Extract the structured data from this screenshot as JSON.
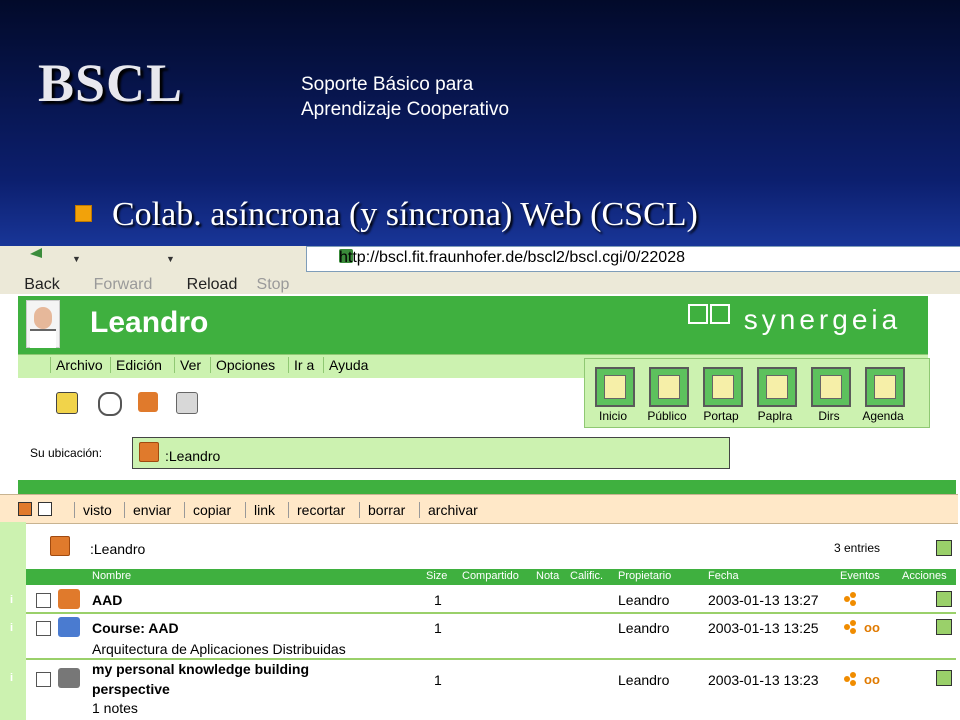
{
  "slide": {
    "title": "BSCL",
    "subtitle_line1": "Soporte Básico para",
    "subtitle_line2": "Aprendizaje Cooperativo",
    "bullet": "Colab. asíncrona (y síncrona) Web (CSCL)"
  },
  "browser": {
    "back": "Back",
    "forward": "Forward",
    "reload": "Reload",
    "stop": "Stop",
    "url": "http://bscl.fit.fraunhofer.de/bscl2/bscl.cgi/0/22028"
  },
  "app": {
    "user_name": "Leandro",
    "logo_text": "synergeia",
    "menu": [
      "Archivo",
      "Edición",
      "Ver",
      "Opciones",
      "Ir a",
      "Ayuda"
    ],
    "nav": [
      "Inicio",
      "Público",
      "Portap",
      "Paplra",
      "Dirs",
      "Agenda"
    ],
    "location_label": "Su ubicación:",
    "location_value": ":Leandro",
    "actions": [
      "visto",
      "enviar",
      "copiar",
      "link",
      "recortar",
      "borrar",
      "archivar"
    ],
    "folder_name": ":Leandro",
    "entries_count": "3 entries",
    "columns": [
      "Nombre",
      "Size",
      "Compartido",
      "Nota",
      "Calific.",
      "Propietario",
      "Fecha",
      "Eventos",
      "Acciones"
    ],
    "rows": [
      {
        "name": "AAD",
        "desc": "",
        "size": "1",
        "owner": "Leandro",
        "date": "2003-01-13 13:27"
      },
      {
        "name": "Course: AAD",
        "desc": "Arquitectura de Aplicaciones Distribuidas",
        "size": "1",
        "owner": "Leandro",
        "date": "2003-01-13 13:25"
      },
      {
        "name": "my personal knowledge building",
        "name2": "perspective",
        "desc": "1 notes",
        "size": "1",
        "owner": "Leandro",
        "date": "2003-01-13 13:23"
      }
    ]
  },
  "colors": {
    "accent_green": "#3fb03f",
    "light_green": "#ccf2b0",
    "bullet_orange": "#f2a20a"
  }
}
